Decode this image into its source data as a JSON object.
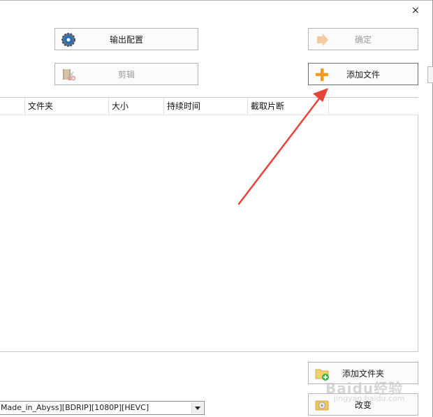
{
  "window": {
    "close_glyph": "×"
  },
  "buttons": {
    "output_config": "输出配置",
    "ok": "确定",
    "clip": "剪辑",
    "add_file": "添加文件",
    "add_folder": "添加文件夹",
    "change": "改变"
  },
  "file_list": {
    "columns": [
      "",
      "文件夹",
      "大小",
      "持续时间",
      "截取片断"
    ],
    "rows": []
  },
  "output_profile": {
    "selected": "Made_in_Abyss][BDRIP][1080P][HEVC]"
  },
  "watermark": {
    "text": "Baidu经验",
    "sub": "jingyan.baidu.com"
  },
  "colors": {
    "annotation_arrow": "#e8443a",
    "add_icon": "#f29b24"
  }
}
